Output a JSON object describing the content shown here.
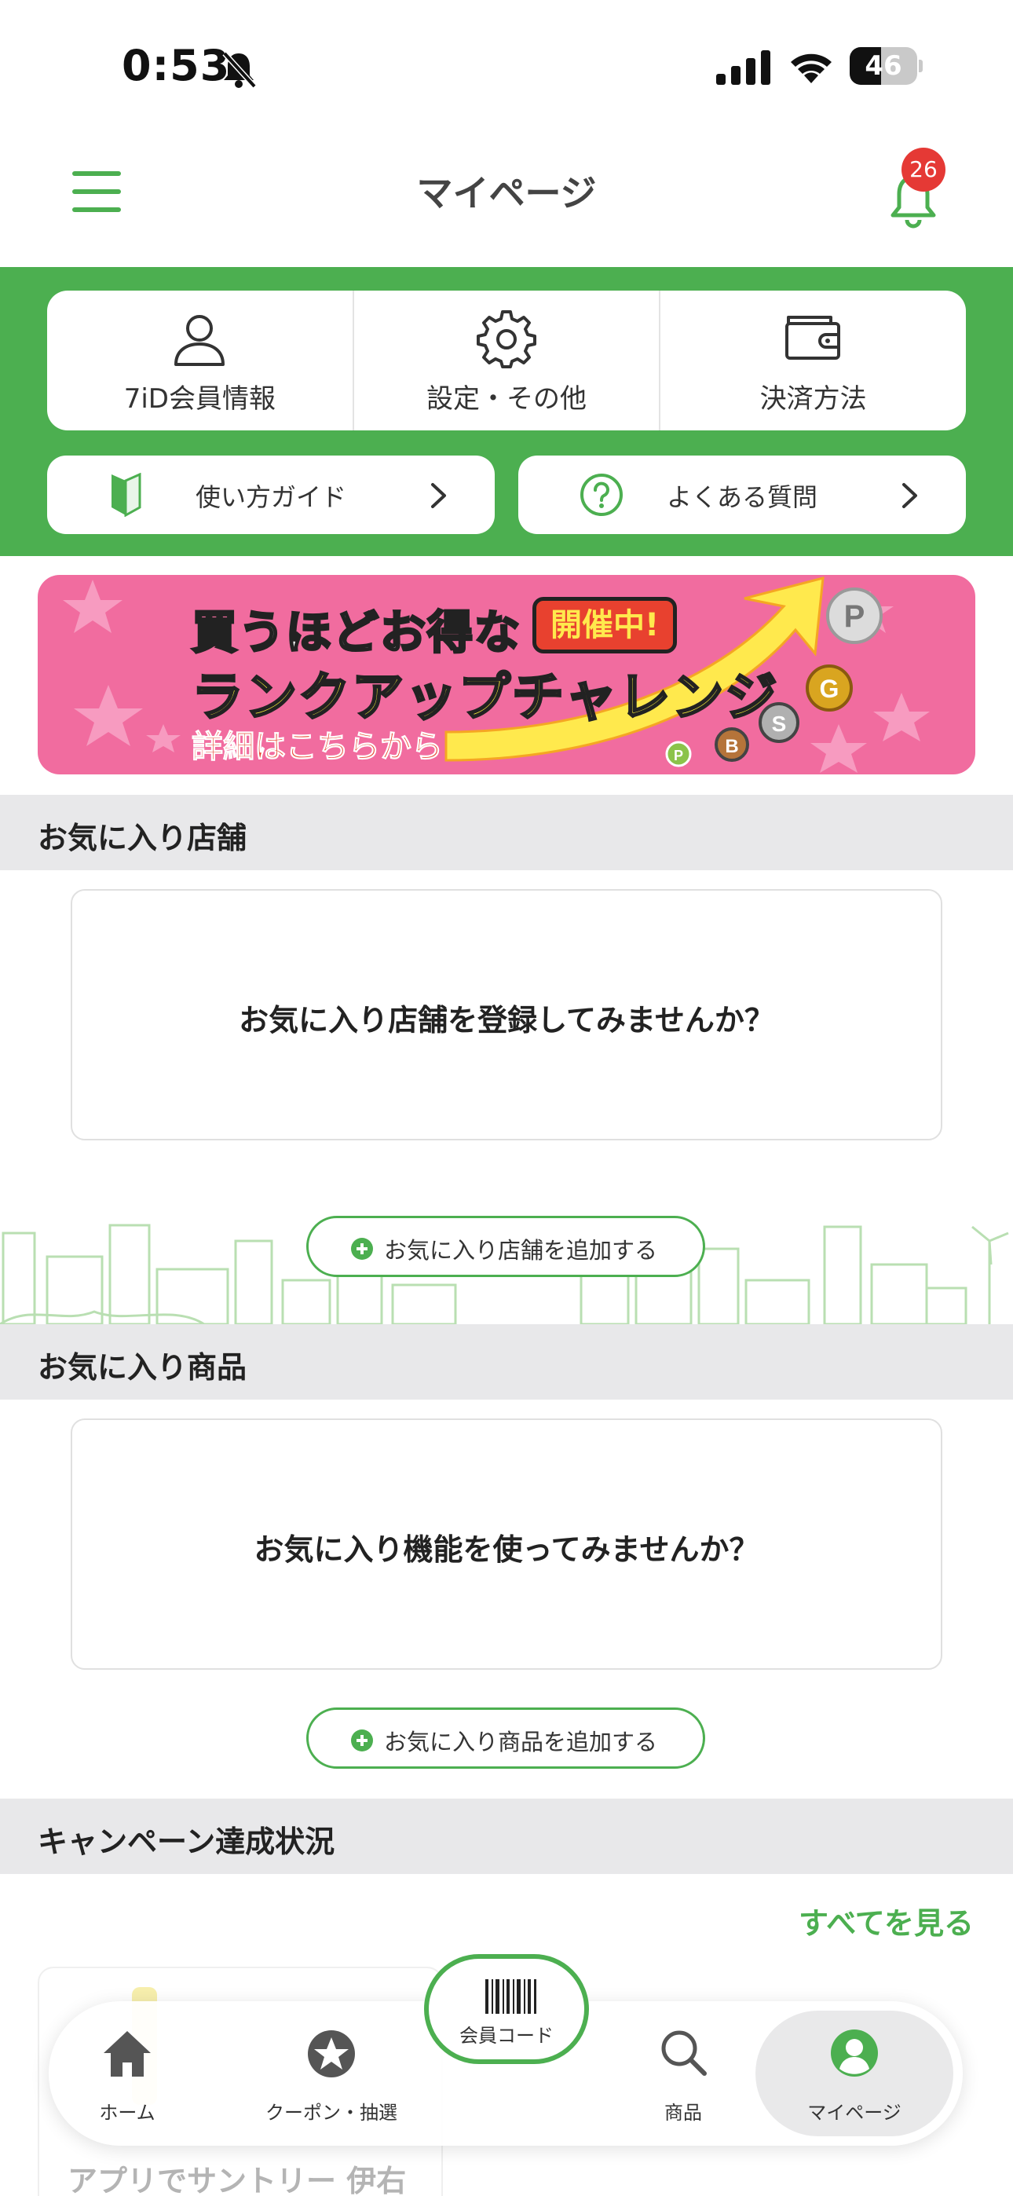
{
  "status_bar": {
    "time": "0:53",
    "battery": "46",
    "battery_level": 0.46
  },
  "header": {
    "title": "マイページ",
    "notification_count": "26"
  },
  "quick_tiles": [
    {
      "label": "7iD会員情報",
      "icon": "person-icon"
    },
    {
      "label": "設定・その他",
      "icon": "gear-icon"
    },
    {
      "label": "決済方法",
      "icon": "wallet-icon"
    }
  ],
  "guide_buttons": {
    "howto": "使い方ガイド",
    "faq": "よくある質問"
  },
  "banner": {
    "line1": "買うほどお得な",
    "tag": "開催中!",
    "line2": "ランクアップチャレンジ",
    "line3": "詳細はこちらから",
    "medals": [
      "P",
      "G",
      "S",
      "B",
      "P"
    ]
  },
  "favorite_stores": {
    "heading": "お気に入り店舗",
    "empty_message": "お気に入り店舗を登録してみませんか？",
    "add_button": "お気に入り店舗を追加する"
  },
  "favorite_products": {
    "heading": "お気に入り商品",
    "empty_message": "お気に入り機能を使ってみませんか？",
    "add_button": "お気に入り商品を追加する"
  },
  "campaign": {
    "heading": "キャンペーン達成状況",
    "see_all": "すべてを見る",
    "card_title": "アプリでサントリー 伊右"
  },
  "tab_bar": {
    "items": [
      {
        "label": "ホーム",
        "icon": "home-icon"
      },
      {
        "label": "クーポン・抽選",
        "icon": "star-coin-icon"
      },
      {
        "label": "商品",
        "icon": "search-icon"
      },
      {
        "label": "マイページ",
        "icon": "person-circle-icon",
        "active": true
      }
    ],
    "code_button": "会員コード"
  },
  "colors": {
    "accent": "#4caf50",
    "badge": "#e53935",
    "banner_bg": "#f16c9f"
  }
}
